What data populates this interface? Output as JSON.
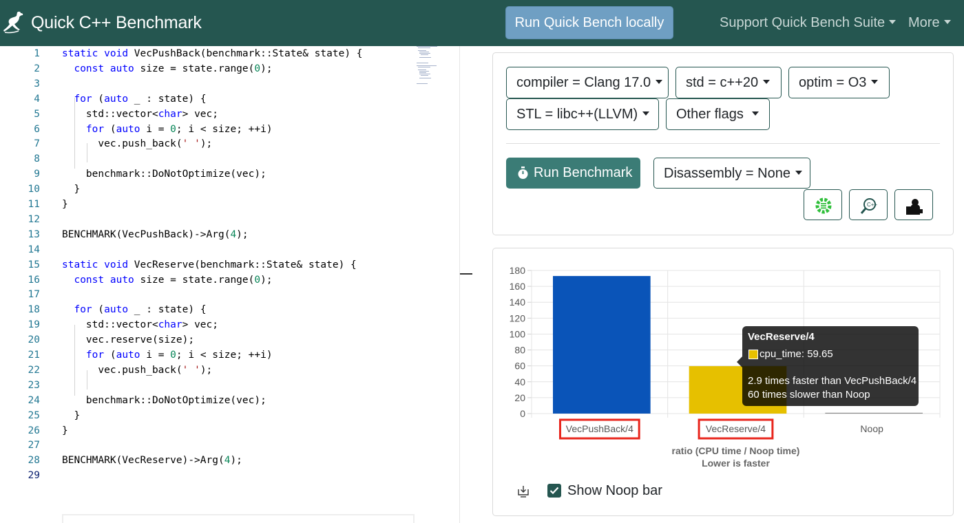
{
  "navbar": {
    "brand": "Quick C++ Benchmark",
    "run_local": "Run Quick Bench locally",
    "support": "Support Quick Bench Suite",
    "more": "More",
    "logo_icon": "kangaroo-logo-icon",
    "bg_color": "#255650"
  },
  "editor": {
    "line_numbers": [
      "1",
      "2",
      "3",
      "4",
      "5",
      "6",
      "7",
      "8",
      "9",
      "10",
      "11",
      "12",
      "13",
      "14",
      "15",
      "16",
      "17",
      "18",
      "19",
      "20",
      "21",
      "22",
      "23",
      "24",
      "25",
      "26",
      "27",
      "28",
      "29"
    ],
    "current_line": "29",
    "lines": [
      "static void VecPushBack(benchmark::State& state) {",
      "  const auto size = state.range(0);",
      "",
      "  for (auto _ : state) {",
      "    std::vector<char> vec;",
      "    for (auto i = 0; i < size; ++i)",
      "      vec.push_back(' ');",
      "",
      "    benchmark::DoNotOptimize(vec);",
      "  }",
      "}",
      "",
      "BENCHMARK(VecPushBack)->Arg(4);",
      "",
      "static void VecReserve(benchmark::State& state) {",
      "  const auto size = state.range(0);",
      "",
      "  for (auto _ : state) {",
      "    std::vector<char> vec;",
      "    vec.reserve(size);",
      "    for (auto i = 0; i < size; ++i)",
      "      vec.push_back(' ');",
      "",
      "    benchmark::DoNotOptimize(vec);",
      "  }",
      "}",
      "",
      "BENCHMARK(VecReserve)->Arg(4);",
      ""
    ]
  },
  "options": {
    "compiler": "compiler = Clang 17.0",
    "std": "std = c++20",
    "optim": "optim = O3",
    "stl": "STL = libc++(LLVM)",
    "other_flags": "Other flags",
    "run_benchmark": "Run Benchmark",
    "disassembly": "Disassembly = None",
    "tool_icons": [
      "cppinsights-icon",
      "compiler-explorer-icon",
      "build-bench-icon"
    ]
  },
  "chart_data": {
    "type": "bar",
    "categories": [
      "VecPushBack/4",
      "VecReserve/4",
      "Noop"
    ],
    "series": [
      {
        "name": "cpu_time",
        "values": [
          173,
          59.65,
          1
        ]
      }
    ],
    "colors": [
      "#0a54b8",
      "#e6c000",
      "#888888"
    ],
    "ylim": [
      0,
      180
    ],
    "yticks": [
      "0",
      "20",
      "40",
      "60",
      "80",
      "100",
      "120",
      "140",
      "160",
      "180"
    ],
    "xlabel": "ratio (CPU time / Noop time)",
    "xlabel2": "Lower is faster",
    "highlighted_categories": [
      "VecPushBack/4",
      "VecReserve/4"
    ],
    "highlight_color": "#e8251c",
    "grid": true,
    "tooltip": {
      "title": "VecReserve/4",
      "value_label": "cpu_time: 59.65",
      "line1": "2.9 times faster than VecPushBack/4",
      "line2": "60 times slower than Noop"
    }
  },
  "chart_controls": {
    "show_noop_label": "Show Noop bar",
    "show_noop_checked": true,
    "download_icon": "download-icon"
  }
}
